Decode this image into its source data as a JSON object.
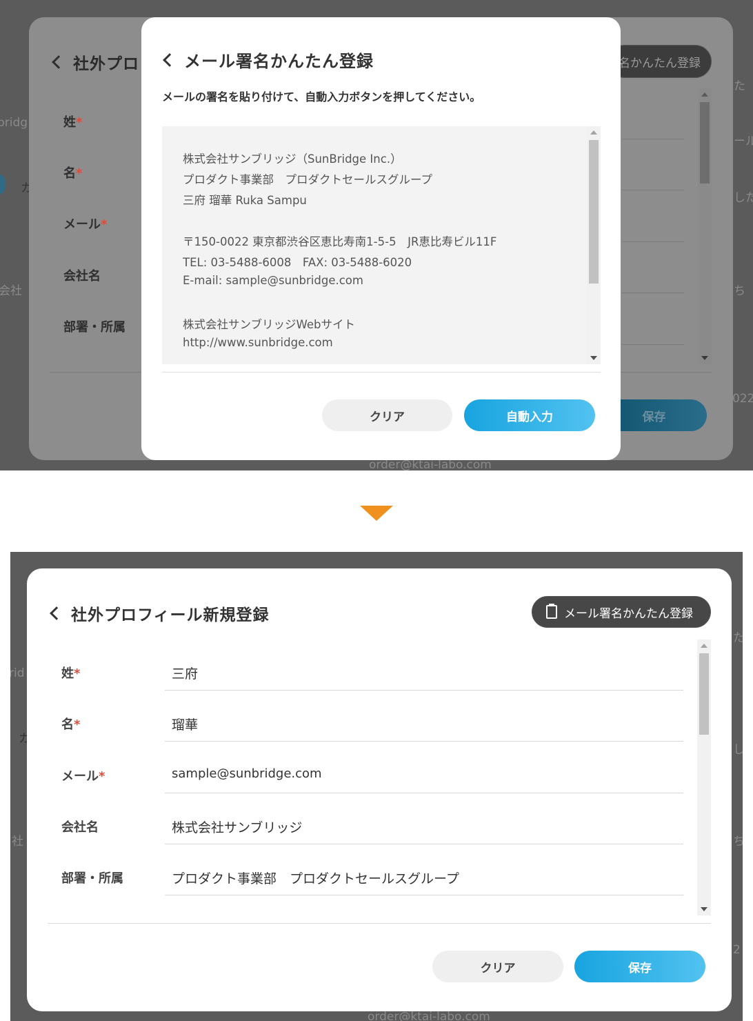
{
  "top": {
    "background": {
      "side_texts": [
        "bridg",
        "カ",
        "会社",
        "た",
        "ール",
        "した",
        "ち",
        "022",
        "order@ktai-labo.com"
      ],
      "badge_partial": "名かんたん登録"
    },
    "form": {
      "title_partial": "社外プロ",
      "labels": [
        "姓",
        "名",
        "メール",
        "会社名",
        "部署・所属"
      ],
      "required_mark": "*",
      "save_label": "保存"
    },
    "modal": {
      "title": "メール署名かんたん登録",
      "instruction": "メールの署名を貼り付けて、自動入力ボタンを押してください。",
      "signature_lines": [
        "株式会社サンブリッジ（SunBridge Inc.）",
        "プロダクト事業部　プロダクトセールスグループ",
        "三府 瑠華 Ruka Sampu",
        "〒150-0022 東京都渋谷区恵比寿南1-5-5　JR恵比寿ビル11F",
        "TEL: 03-5488-6008　FAX: 03-5488-6020",
        "E-mail: sample@sunbridge.com",
        "株式会社サンブリッジWebサイト",
        "http://www.sunbridge.com"
      ],
      "clear_label": "クリア",
      "autofill_label": "自動入力"
    }
  },
  "divider_arrow_color": "#f0901e",
  "bottom": {
    "background": {
      "side_texts": [
        "rid",
        "カ",
        "社",
        "た",
        "し",
        "ち",
        "2",
        "order@ktai-labo.com"
      ]
    },
    "title": "社外プロフィール新規登録",
    "signature_button_label": "メール署名かんたん登録",
    "fields": [
      {
        "label": "姓",
        "required": true,
        "value": "三府"
      },
      {
        "label": "名",
        "required": true,
        "value": "瑠華"
      },
      {
        "label": "メール",
        "required": true,
        "value": "sample@sunbridge.com"
      },
      {
        "label": "会社名",
        "required": false,
        "value": "株式会社サンブリッジ"
      },
      {
        "label": "部署・所属",
        "required": false,
        "value": "プロダクト事業部　プロダクトセールスグループ"
      }
    ],
    "required_mark": "*",
    "clear_label": "クリア",
    "save_label": "保存"
  },
  "colors": {
    "primary": "#18a4e0",
    "required": "#e04b3a",
    "accent_arrow": "#f0901e"
  }
}
